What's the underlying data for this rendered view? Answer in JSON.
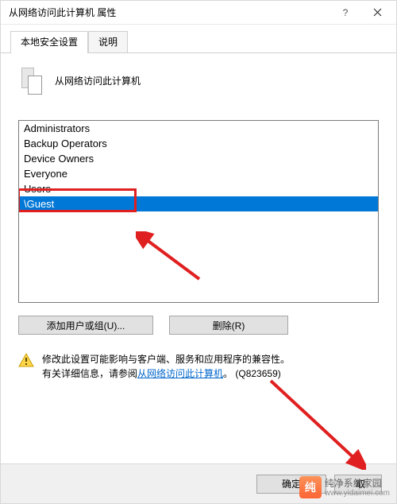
{
  "window": {
    "title": "从网络访问此计算机 属性"
  },
  "tabs": {
    "active": "本地安全设置",
    "inactive": "说明"
  },
  "page": {
    "policy_title": "从网络访问此计算机"
  },
  "list": {
    "items": [
      "Administrators",
      "Backup Operators",
      "Device Owners",
      "Everyone",
      "Users",
      "\\Guest"
    ],
    "selected_index": 5
  },
  "buttons": {
    "add": "添加用户或组(U)...",
    "delete": "删除(R)"
  },
  "warning": {
    "line1": "修改此设置可能影响与客户端、服务和应用程序的兼容性。",
    "line2_prefix": "有关详细信息，请参阅",
    "link_text": "从网络访问此计算机",
    "line2_suffix": "。 (Q823659)"
  },
  "footer": {
    "ok": "确定",
    "cancel_partial": "取"
  },
  "watermark": {
    "brand": "纯净系统家园",
    "url": "www.yidaimei.com"
  }
}
